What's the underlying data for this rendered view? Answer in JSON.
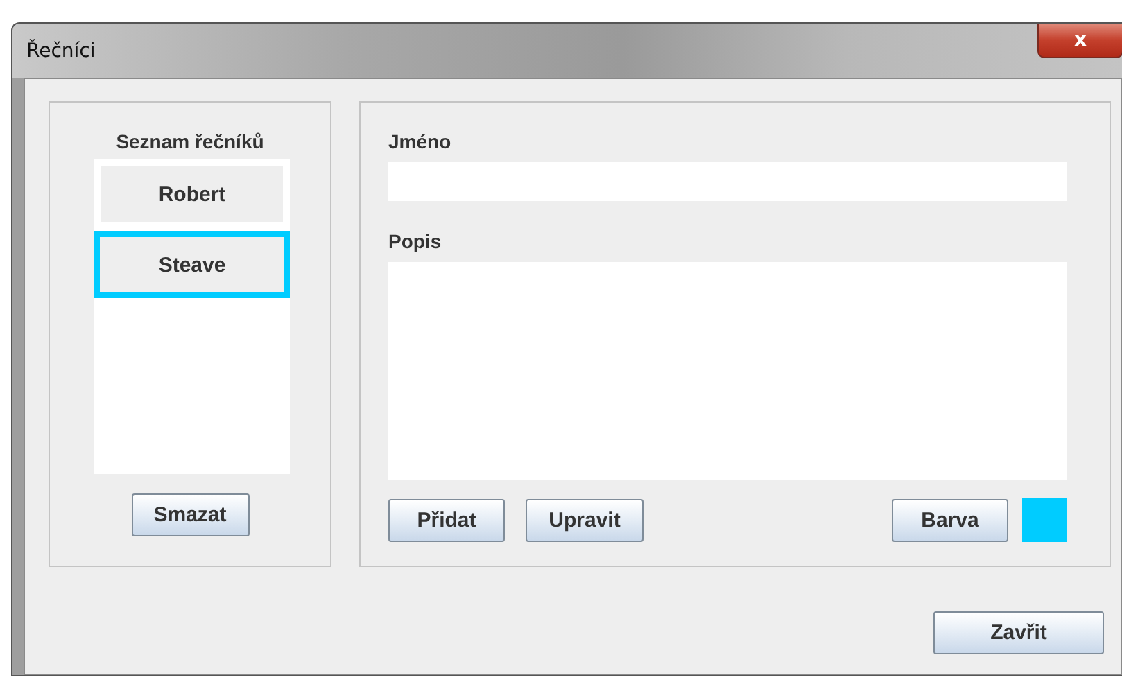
{
  "window": {
    "title": "Řečníci",
    "close": "x"
  },
  "speakers": {
    "title": "Seznam řečníků",
    "items": [
      {
        "name": "Robert",
        "selected": false
      },
      {
        "name": "Steave",
        "selected": true
      }
    ],
    "delete": "Smazat"
  },
  "detail": {
    "name_label": "Jméno",
    "description_label": "Popis",
    "add": "Přidat",
    "edit": "Upravit",
    "color_button": "Barva",
    "color": "#00ccff"
  },
  "footer": {
    "close": "Zavřit"
  }
}
